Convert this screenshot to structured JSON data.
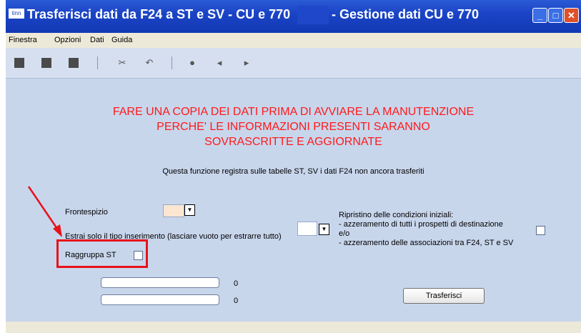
{
  "window": {
    "icon_label": "tinn",
    "title_left": "Trasferisci dati da F24 a ST e SV - CU e 770",
    "title_right": "- Gestione dati CU e 770",
    "controls": [
      "minimize",
      "maximize",
      "close"
    ]
  },
  "menu": [
    "Finestra",
    "Opzioni",
    "Dati",
    "Guida"
  ],
  "toolbar_icons": [
    "new-icon",
    "save-icon",
    "stop-icon",
    "cut-icon",
    "undo-icon",
    "search-icon",
    "back-arrow-icon",
    "forward-arrow-icon"
  ],
  "warning": {
    "line1": "FARE UNA COPIA DEI DATI PRIMA DI AVVIARE LA MANUTENZIONE",
    "line2": "PERCHE' LE INFORMAZIONI PRESENTI SARANNO",
    "line3": "SOVRASCRITTE E AGGIORNATE",
    "color": "#ff1a1a"
  },
  "info": "Questa funzione registra sulle tabelle ST, SV i dati F24 non ancora trasferiti",
  "form": {
    "frontespizio_label": "Frontespizio",
    "frontespizio_value": "",
    "estrai_label": "Estrai solo il tipo inserimento (lasciare vuoto per estrarre tutto)",
    "estrai_value": "",
    "raggruppa_label": "Raggruppa ST",
    "raggruppa_checked": false,
    "ripristino_line1": "Ripristino delle condizioni iniziali:",
    "ripristino_line2": "- azzeramento di tutti i prospetti di destinazione",
    "ripristino_line3": "e/o",
    "ripristino_line4": "- azzeramento delle associazioni tra F24, ST e SV",
    "ripristino_checked": false
  },
  "progress": [
    {
      "value": "0",
      "fraction": 0
    },
    {
      "value": "0",
      "fraction": 0
    }
  ],
  "button_trasferisci": "Trasferisci",
  "annotation_color": "#e8121b"
}
